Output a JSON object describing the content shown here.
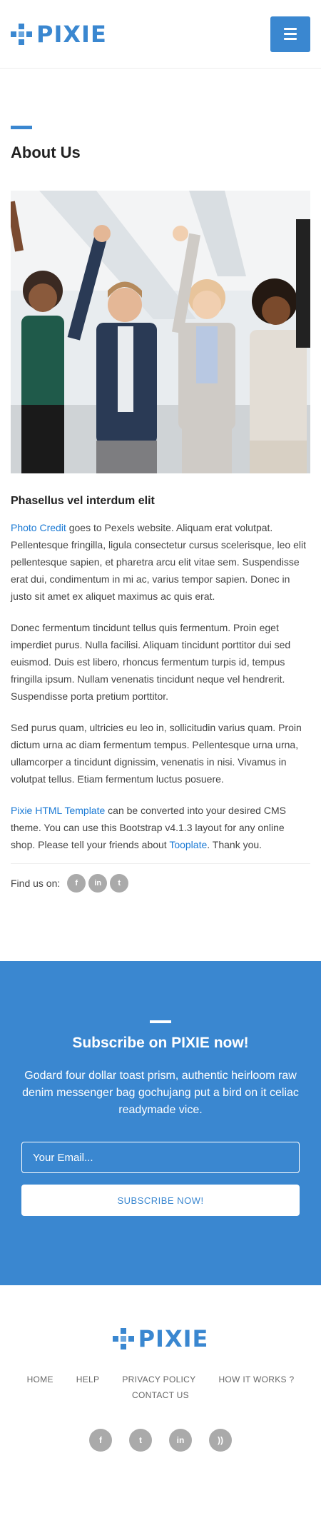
{
  "brand": {
    "name": "PIXIE",
    "color": "#3a87d0"
  },
  "header": {
    "menu_icon": "hamburger-icon"
  },
  "about": {
    "title": "About Us",
    "subtitle": "Phasellus vel interdum elit",
    "para1_link": "Photo Credit",
    "para1_text": " goes to Pexels website. Aliquam erat volutpat. Pellentesque fringilla, ligula consectetur cursus scelerisque, leo elit pellentesque sapien, et pharetra arcu elit vitae sem. Suspendisse erat dui, condimentum in mi ac, varius tempor sapien. Donec in justo sit amet ex aliquet maximus ac quis erat.",
    "para2": "Donec fermentum tincidunt tellus quis fermentum. Proin eget imperdiet purus. Nulla facilisi. Aliquam tincidunt porttitor dui sed euismod. Duis est libero, rhoncus fermentum turpis id, tempus fringilla ipsum. Nullam venenatis tincidunt neque vel hendrerit. Suspendisse porta pretium porttitor.",
    "para3": "Sed purus quam, ultricies eu leo in, sollicitudin varius quam. Proin dictum urna ac diam fermentum tempus. Pellentesque urna urna, ullamcorper a tincidunt dignissim, venenatis in nisi. Vivamus in volutpat tellus. Etiam fermentum luctus posuere.",
    "para4_link1": "Pixie HTML Template",
    "para4_text1": " can be converted into your desired CMS theme. You can use this Bootstrap v4.1.3 layout for any online shop. Please tell your friends about ",
    "para4_link2": "Tooplate",
    "para4_text2": ". Thank you.",
    "find_us": "Find us on:",
    "social": [
      {
        "icon": "facebook-icon",
        "glyph": "f"
      },
      {
        "icon": "linkedin-icon",
        "glyph": "in"
      },
      {
        "icon": "twitter-icon",
        "glyph": "t"
      }
    ]
  },
  "subscribe": {
    "title": "Subscribe on PIXIE now!",
    "text": "Godard four dollar toast prism, authentic heirloom raw denim messenger bag gochujang put a bird on it celiac readymade vice.",
    "email_placeholder": "Your Email...",
    "button": "SUBSCRIBE NOW!"
  },
  "footer": {
    "nav": [
      "HOME",
      "HELP",
      "PRIVACY POLICY",
      "HOW IT WORKS ?",
      "CONTACT US"
    ],
    "social": [
      {
        "icon": "facebook-icon",
        "glyph": "f"
      },
      {
        "icon": "twitter-icon",
        "glyph": "t"
      },
      {
        "icon": "linkedin-icon",
        "glyph": "in"
      },
      {
        "icon": "rss-icon",
        "glyph": "))"
      }
    ]
  }
}
